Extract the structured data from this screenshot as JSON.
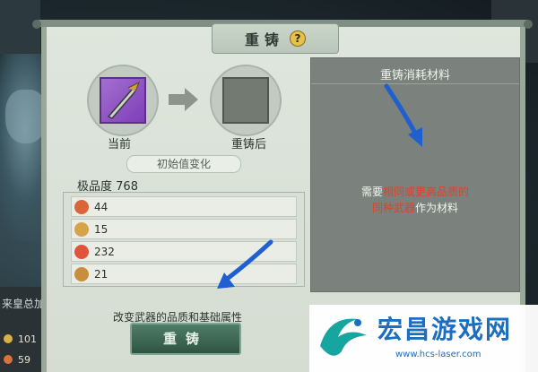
{
  "background": {
    "side_text": "来皇总加成",
    "stats": [
      {
        "value": "101",
        "icon": "attack-icon",
        "color": "#d9b043"
      },
      {
        "value": "59",
        "icon": "defense-icon",
        "color": "#d9733a"
      }
    ]
  },
  "dialog": {
    "title": "重铸",
    "help_glyph": "?",
    "current_label": "当前",
    "after_label": "重铸后",
    "section_label": "初始值变化",
    "grade_label": "极品度",
    "grade_value": "768",
    "stats": [
      {
        "icon": "sword-attack-icon",
        "value": "44",
        "color": "#d9663a"
      },
      {
        "icon": "hp-icon",
        "value": "15",
        "color": "#d6a24a"
      },
      {
        "icon": "flame-icon",
        "value": "232",
        "color": "#e0543c"
      },
      {
        "icon": "shield-icon",
        "value": "21",
        "color": "#c98e3c"
      }
    ],
    "description": "改变武器的品质和基础属性",
    "button_label": "重铸"
  },
  "cost_panel": {
    "title": "重铸消耗材料",
    "msg_prefix": "需要",
    "msg_highlight1": "相同或更高品质的",
    "msg_highlight2": "同种武器",
    "msg_suffix": "作为材料"
  },
  "watermark": {
    "name": "宏昌游戏网",
    "url": "www.hcs-laser.com"
  },
  "colors": {
    "highlight": "#e2402c",
    "button": "#2e5443",
    "annotation_arrow": "#1f5fd0"
  }
}
